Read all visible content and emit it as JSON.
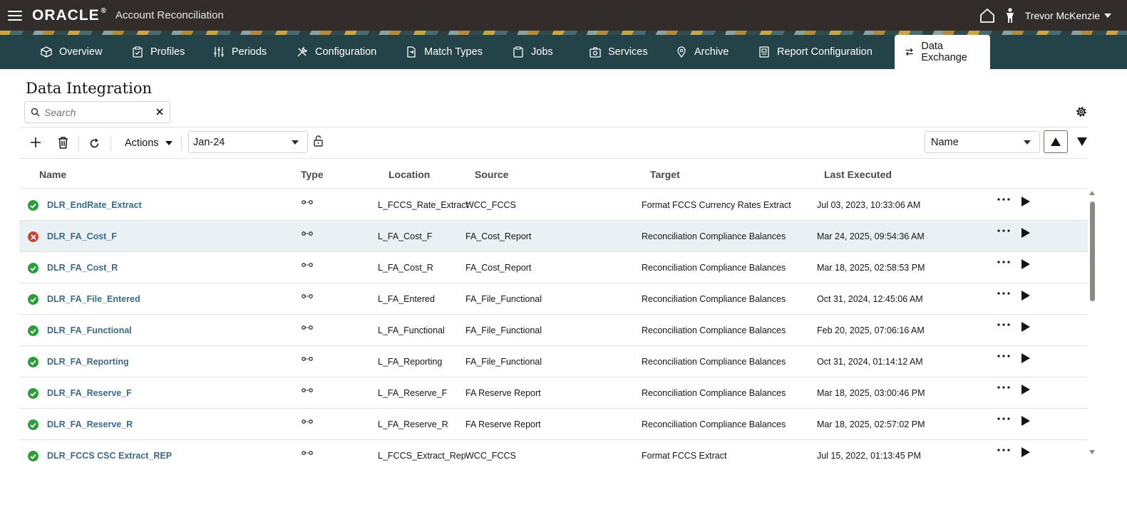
{
  "header": {
    "brand": "ORACLE",
    "app_title": "Account Reconciliation",
    "user_name": "Trevor McKenzie"
  },
  "nav": {
    "items": [
      {
        "label": "Overview",
        "icon": "cube-icon"
      },
      {
        "label": "Profiles",
        "icon": "clipboard-check-icon"
      },
      {
        "label": "Periods",
        "icon": "sliders-icon"
      },
      {
        "label": "Configuration",
        "icon": "tools-icon"
      },
      {
        "label": "Match Types",
        "icon": "document-icon"
      },
      {
        "label": "Jobs",
        "icon": "clipboard-icon"
      },
      {
        "label": "Services",
        "icon": "camera-icon"
      },
      {
        "label": "Archive",
        "icon": "location-pin-icon"
      },
      {
        "label": "Report Configuration",
        "icon": "report-icon"
      },
      {
        "label": "Data Exchange",
        "icon": "exchange-arrows-icon"
      }
    ],
    "active": "Data Exchange"
  },
  "page": {
    "title": "Data Integration",
    "search_placeholder": "Search"
  },
  "toolbar": {
    "actions_label": "Actions",
    "period_value": "Jan-24",
    "sort_field": "Name"
  },
  "table": {
    "columns": {
      "name": "Name",
      "type": "Type",
      "location": "Location",
      "source": "Source",
      "target": "Target",
      "last_executed": "Last Executed"
    },
    "rows": [
      {
        "status": "success",
        "name": "DLR_EndRate_Extract",
        "location": "L_FCCS_Rate_Extract",
        "source": "WCC_FCCS",
        "target": "Format FCCS Currency Rates Extract",
        "last_executed": "Jul 03, 2023, 10:33:06 AM"
      },
      {
        "status": "error",
        "name": "DLR_FA_Cost_F",
        "location": "L_FA_Cost_F",
        "source": "FA_Cost_Report",
        "target": "Reconciliation Compliance Balances",
        "last_executed": "Mar 24, 2025, 09:54:36 AM"
      },
      {
        "status": "success",
        "name": "DLR_FA_Cost_R",
        "location": "L_FA_Cost_R",
        "source": "FA_Cost_Report",
        "target": "Reconciliation Compliance Balances",
        "last_executed": "Mar 18, 2025, 02:58:53 PM"
      },
      {
        "status": "success",
        "name": "DLR_FA_File_Entered",
        "location": "L_FA_Entered",
        "source": "FA_File_Functional",
        "target": "Reconciliation Compliance Balances",
        "last_executed": "Oct 31, 2024, 12:45:06 AM"
      },
      {
        "status": "success",
        "name": "DLR_FA_Functional",
        "location": "L_FA_Functional",
        "source": "FA_File_Functional",
        "target": "Reconciliation Compliance Balances",
        "last_executed": "Feb 20, 2025, 07:06:16 AM"
      },
      {
        "status": "success",
        "name": "DLR_FA_Reporting",
        "location": "L_FA_Reporting",
        "source": "FA_File_Functional",
        "target": "Reconciliation Compliance Balances",
        "last_executed": "Oct 31, 2024, 01:14:12 AM"
      },
      {
        "status": "success",
        "name": "DLR_FA_Reserve_F",
        "location": "L_FA_Reserve_F",
        "source": "FA Reserve Report",
        "target": "Reconciliation Compliance Balances",
        "last_executed": "Mar 18, 2025, 03:00:46 PM"
      },
      {
        "status": "success",
        "name": "DLR_FA_Reserve_R",
        "location": "L_FA_Reserve_R",
        "source": "FA Reserve Report",
        "target": "Reconciliation Compliance Balances",
        "last_executed": "Mar 18, 2025, 02:57:02 PM"
      },
      {
        "status": "success",
        "name": "DLR_FCCS CSC Extract_REP",
        "location": "L_FCCS_Extract_Rep",
        "source": "WCC_FCCS",
        "target": "Format FCCS Extract",
        "last_executed": "Jul 15, 2022, 01:13:45 PM"
      }
    ],
    "selected_row": 1
  },
  "colors": {
    "topbar": "#312d2a",
    "navbar": "#244349",
    "link": "#3a6b83",
    "success": "#2d9c3c",
    "error": "#c74634",
    "selected_row": "#e9f1f5"
  }
}
